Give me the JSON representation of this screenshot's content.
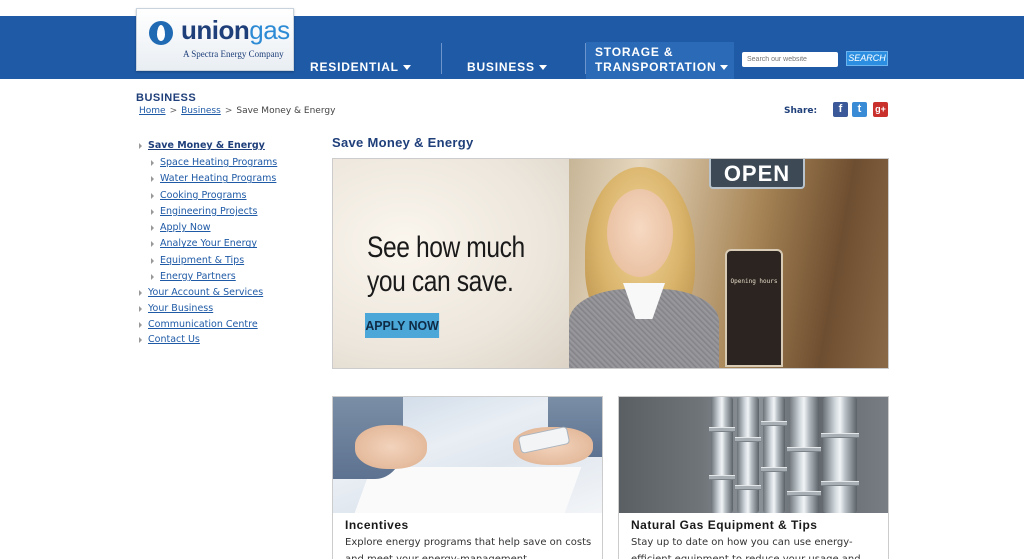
{
  "brand": {
    "name_part1": "union",
    "name_part2": "gas",
    "tagline": "A Spectra Energy Company"
  },
  "nav": {
    "residential": "RESIDENTIAL",
    "business": "BUSINESS",
    "storage_line1": "STORAGE &",
    "storage_line2": "TRANSPORTATION"
  },
  "search": {
    "placeholder": "Search our website",
    "button": "SEARCH"
  },
  "page": {
    "section": "BUSINESS",
    "breadcrumb": [
      "Home",
      "Business",
      "Save Money & Energy"
    ],
    "share_label": "Share:",
    "social": [
      "facebook",
      "twitter",
      "google-plus"
    ]
  },
  "sidebar": {
    "items": [
      {
        "label": "Save Money & Energy",
        "level": 1,
        "active": true
      },
      {
        "label": "Space Heating Programs",
        "level": 2
      },
      {
        "label": "Water Heating Programs",
        "level": 2
      },
      {
        "label": "Cooking Programs",
        "level": 2
      },
      {
        "label": "Engineering Projects",
        "level": 2
      },
      {
        "label": "Apply Now",
        "level": 2
      },
      {
        "label": "Analyze Your Energy",
        "level": 2
      },
      {
        "label": "Equipment & Tips",
        "level": 2
      },
      {
        "label": "Energy Partners",
        "level": 2
      },
      {
        "label": "Your Account & Services",
        "level": 1
      },
      {
        "label": "Your Business",
        "level": 1
      },
      {
        "label": "Communication Centre",
        "level": 1
      },
      {
        "label": "Contact Us",
        "level": 1
      }
    ]
  },
  "main": {
    "title": "Save Money & Energy",
    "hero": {
      "headline_line1": "See how much",
      "headline_line2": "you can save.",
      "cta": "APPLY NOW",
      "open_sign": "OPEN",
      "hours_sign": "Opening hours"
    },
    "cards": [
      {
        "title": "Incentives",
        "text": "Explore energy programs that help save on costs and meet your energy-management"
      },
      {
        "title": "Natural Gas Equipment & Tips",
        "text": "Stay up to date on how you can use energy-efficient equipment to reduce your usage and"
      }
    ]
  },
  "colors": {
    "header_blue": "#1f5aa6",
    "nav_active": "#2b6ab6",
    "link_blue": "#1f5aa6",
    "title_navy": "#1f3f7a",
    "cta_blue": "#4aa7d8",
    "search_button": "#2b8ee0"
  },
  "icons": [
    "caret-down-icon",
    "facebook-icon",
    "twitter-icon",
    "google-plus-icon",
    "bullet-arrow-icon",
    "flame-logo-icon"
  ]
}
